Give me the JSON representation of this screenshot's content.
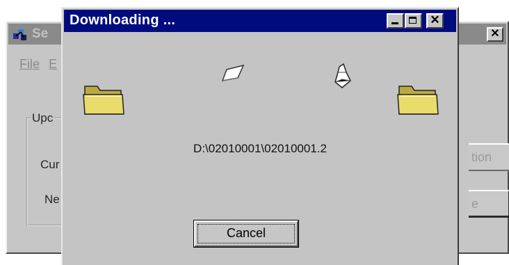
{
  "background_window": {
    "title": "Se",
    "menu": {
      "file": "File",
      "second": "E"
    },
    "group_label": "Upc",
    "label_1": "Cur",
    "label_2": "Ne",
    "button_1": "tion",
    "button_2": "e",
    "close_glyph": "✕"
  },
  "dialog": {
    "title": "Downloading ...",
    "file_path": "D:\\02010001\\02010001.2",
    "cancel_label": "Cancel",
    "close_glyph": "✕"
  },
  "colors": {
    "title_bar": "#000c7e",
    "face": "#c4c4c4",
    "folder": "#e9dc6a"
  },
  "icons": [
    "app-icon",
    "folder-icon",
    "document-icon",
    "minimize-icon",
    "maximize-icon",
    "close-icon"
  ]
}
